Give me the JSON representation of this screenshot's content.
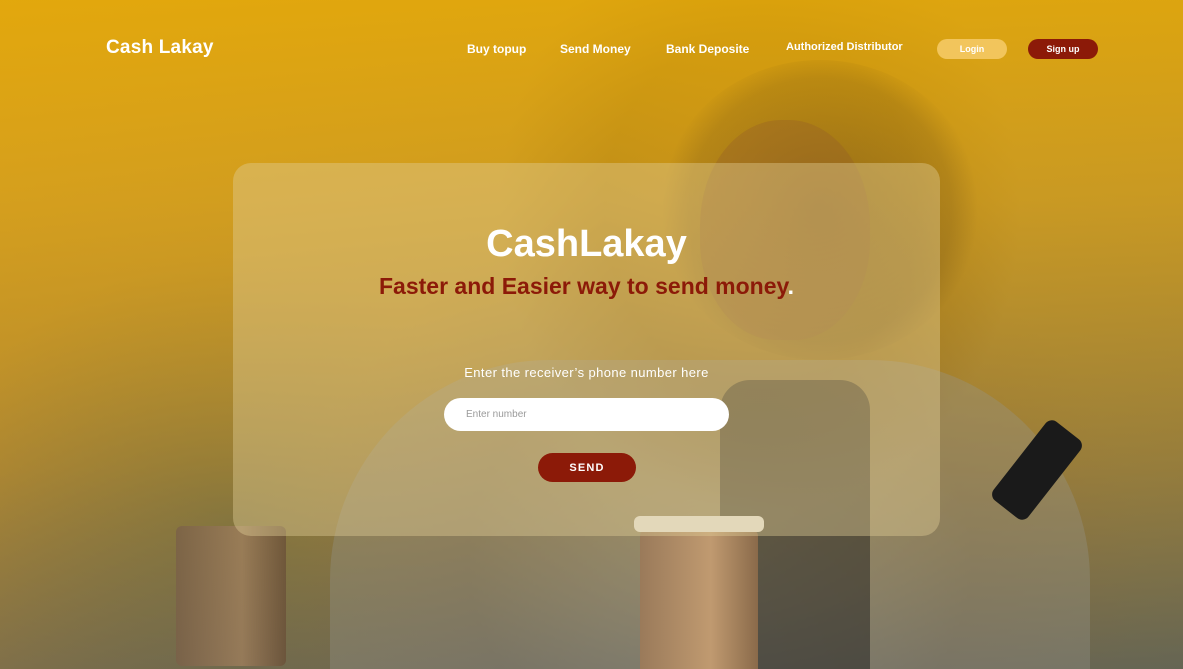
{
  "nav": {
    "logo": "Cash Lakay",
    "links": [
      "Buy topup",
      "Send Money",
      "Bank Deposite",
      "Authorized Distributor"
    ],
    "login_label": "Login",
    "signup_label": "Sign up"
  },
  "hero": {
    "title": "CashLakay",
    "tagline": "Faster and Easier way to send money",
    "tagline_dot": ".",
    "field_label": "Enter the receiver’s phone number here",
    "input_placeholder": "Enter number",
    "send_label": "SEND"
  },
  "colors": {
    "brand_yellow": "#E6AA0A",
    "brand_red": "#8C1A08",
    "login_bg": "#F2C55C"
  }
}
